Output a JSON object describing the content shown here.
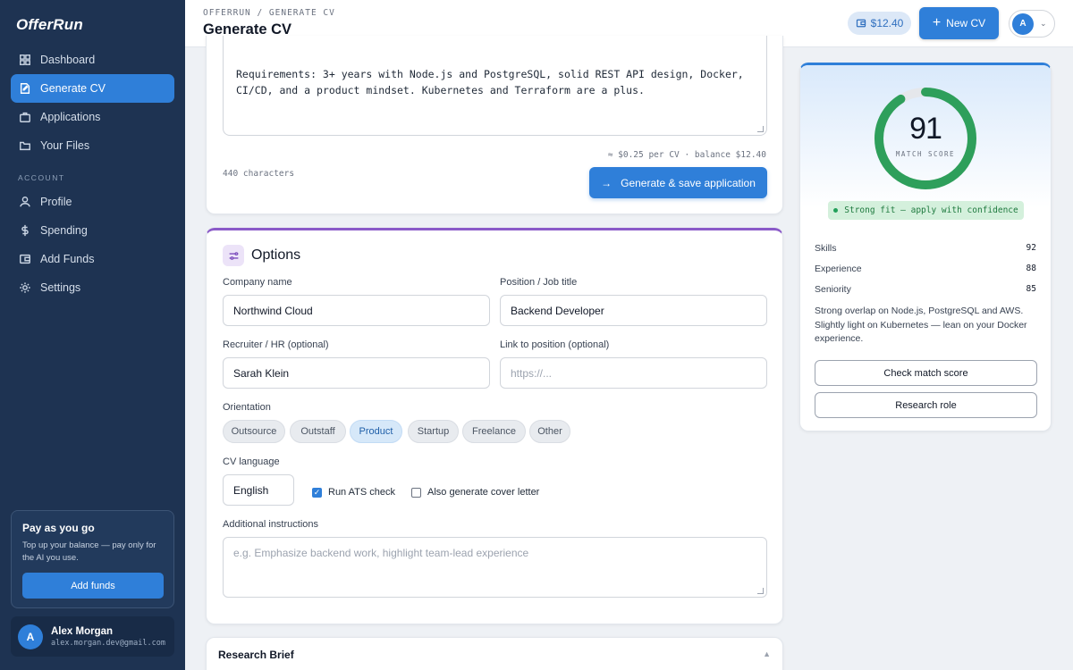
{
  "app": {
    "logo": "OfferRun"
  },
  "sidebar": {
    "items": [
      {
        "label": "Dashboard"
      },
      {
        "label": "Generate CV"
      },
      {
        "label": "Applications"
      },
      {
        "label": "Your Files"
      }
    ],
    "account_label": "ACCOUNT",
    "account_items": [
      {
        "label": "Profile"
      },
      {
        "label": "Spending"
      },
      {
        "label": "Add Funds"
      },
      {
        "label": "Settings"
      }
    ],
    "promo": {
      "title": "Pay as you go",
      "text": "Top up your balance — pay only for the AI you use.",
      "button": "Add funds"
    },
    "user": {
      "initial": "A",
      "name": "Alex Morgan",
      "email": "alex.morgan.dev@gmail.com"
    }
  },
  "header": {
    "breadcrumb": "OFFERRUN / GENERATE CV",
    "title": "Generate CV",
    "balance": "$12.40",
    "new_cv": "New CV",
    "avatar_initial": "A"
  },
  "job": {
    "description": "Requirements: 3+ years with Node.js and PostgreSQL, solid REST API design, Docker, CI/CD, and a product mindset. Kubernetes and Terraform are a plus.",
    "cost_note": "≈ $0.25 per CV · balance $12.40",
    "char_count": "440 characters",
    "generate_button": "Generate & save application"
  },
  "options": {
    "title": "Options",
    "company_label": "Company name",
    "company_value": "Northwind Cloud",
    "position_label": "Position / Job title",
    "position_value": "Backend Developer",
    "recruiter_label": "Recruiter / HR (optional)",
    "recruiter_value": "Sarah Klein",
    "link_label": "Link to position (optional)",
    "link_placeholder": "https://...",
    "orientation_label": "Orientation",
    "orientation": [
      "Outsource",
      "Outstaff",
      "Product",
      "Startup",
      "Freelance",
      "Other"
    ],
    "orientation_selected": "Product",
    "language_label": "CV language",
    "language_value": "English",
    "ats_label": "Run ATS check",
    "ats_checked": true,
    "cover_label": "Also generate cover letter",
    "cover_checked": false,
    "instructions_label": "Additional instructions",
    "instructions_placeholder": "e.g. Emphasize backend work, highlight team-lead experience"
  },
  "research": {
    "title": "Research Brief"
  },
  "score": {
    "value": 91,
    "label": "MATCH SCORE",
    "fit": "Strong fit — apply with confidence",
    "metrics": [
      {
        "name": "Skills",
        "value": "92"
      },
      {
        "name": "Experience",
        "value": "88"
      },
      {
        "name": "Seniority",
        "value": "85"
      }
    ],
    "note": "Strong overlap on Node.js, PostgreSQL and AWS. Slightly light on Kubernetes — lean on your Docker experience.",
    "check_button": "Check match score",
    "research_button": "Research role",
    "colors": {
      "ring": "#2e9f5b",
      "track": "#e5e7eb"
    }
  }
}
